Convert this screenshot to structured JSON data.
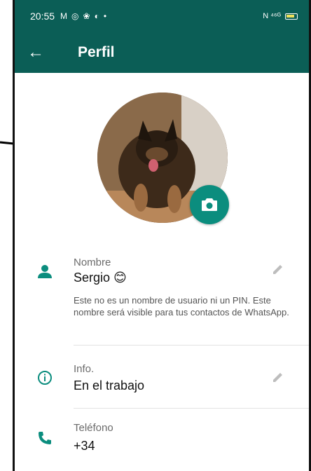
{
  "statusbar": {
    "time": "20:55",
    "notification_icons": [
      "gmail-icon",
      "instagram-icon",
      "messenger-icon",
      "app-icon"
    ],
    "right_text": "N ⁴⁶ᴳ"
  },
  "appbar": {
    "back_icon": "arrow-left-icon",
    "title": "Perfil"
  },
  "profile": {
    "camera_icon": "camera-icon"
  },
  "fields": {
    "name": {
      "label": "Nombre",
      "value": "Sergio 😊",
      "helper": "Este no es un nombre de usuario ni un PIN. Este nombre será visible para tus contactos de WhatsApp."
    },
    "info": {
      "label": "Info.",
      "value": "En el trabajo"
    },
    "phone": {
      "label": "Teléfono",
      "value": "+34"
    }
  },
  "colors": {
    "header": "#0b5e56",
    "accent": "#0b8d7e",
    "icon": "#0b8d7e"
  }
}
